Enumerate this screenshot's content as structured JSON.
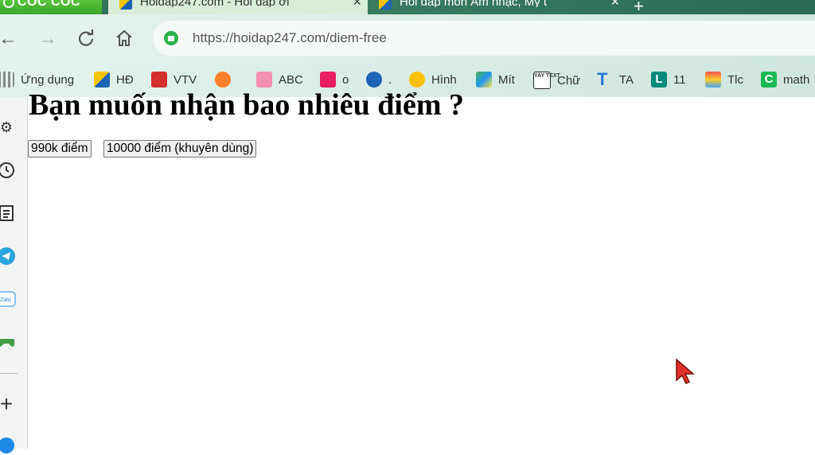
{
  "browser": {
    "brand": "CỐC CỐC",
    "tabs": [
      {
        "title": "Hoidap247.com - Hỏi đáp ơi",
        "active": true
      },
      {
        "title": "Hỏi đáp môn Âm nhạc, Mỹ t",
        "active": false
      }
    ],
    "new_tab_icon": "+",
    "address_url": "https://hoidap247.com/diem-free"
  },
  "bookmarks": [
    {
      "label": "Ứng dụng",
      "icon": "apps-grid-icon",
      "color": "#9e9e9e"
    },
    {
      "label": "HĐ",
      "icon": "hoidap-icon",
      "color": "#f5c400"
    },
    {
      "label": "VTV",
      "icon": "vtv-icon",
      "color": "#d32f2f"
    },
    {
      "label": "",
      "icon": "orange-circle-icon",
      "color": "#ff7f2a"
    },
    {
      "label": "ABC",
      "icon": "abc-doc-icon",
      "color": "#f48fb1"
    },
    {
      "label": "o",
      "icon": "pink-face-icon",
      "color": "#e91e63"
    },
    {
      "label": ".",
      "icon": "k-circle-icon",
      "color": "#1e63b6"
    },
    {
      "label": "Hình",
      "icon": "smiley-icon",
      "color": "#ffc107"
    },
    {
      "label": "Mít",
      "icon": "photo-icon",
      "color": "#4caf50"
    },
    {
      "label": "Chữ",
      "icon": "yay-text-icon",
      "color": "#222222"
    },
    {
      "label": "TA",
      "icon": "t-letter-icon",
      "color": "#2b7bd4"
    },
    {
      "label": "11",
      "icon": "l-letter-icon",
      "color": "#00897b"
    },
    {
      "label": "Tlc",
      "icon": "rainbow-icon",
      "color": "#ef5350"
    },
    {
      "label": "math",
      "icon": "c-letter-icon",
      "color": "#1db954"
    }
  ],
  "page": {
    "heading": "Bạn muốn nhận bao nhiêu điểm ?",
    "options": [
      "990k điểm",
      "10000 điểm (khuyên dùng)"
    ]
  }
}
